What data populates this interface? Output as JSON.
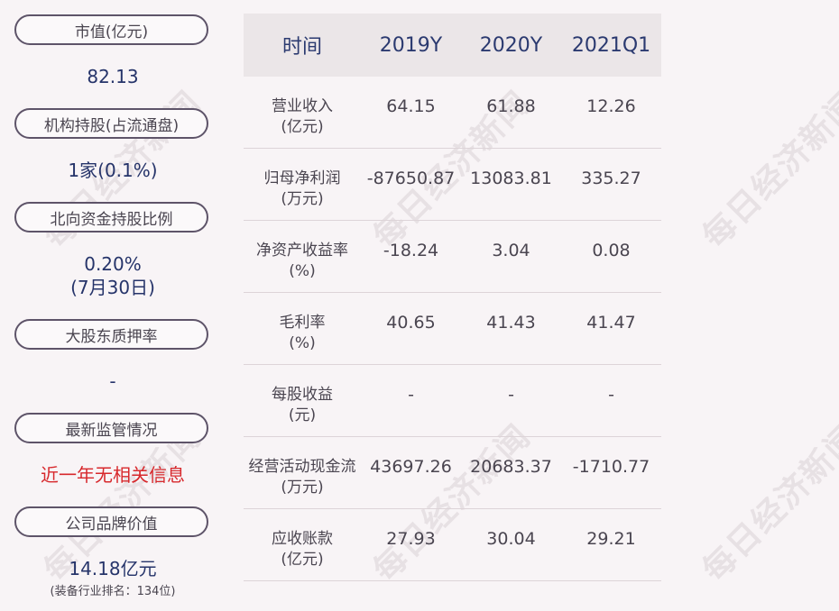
{
  "left": {
    "market_cap_label": "市值(亿元)",
    "market_cap_value": "82.13",
    "institution_label": "机构持股(占流通盘)",
    "institution_value": "1家(0.1%)",
    "northbound_label": "北向资金持股比例",
    "northbound_value": "0.20%",
    "northbound_date": "(7月30日)",
    "pledge_label": "大股东质押率",
    "pledge_value": "-",
    "regulation_label": "最新监管情况",
    "regulation_value": "近一年无相关信息",
    "brand_label": "公司品牌价值",
    "brand_value": "14.18亿元",
    "brand_note": "(装备行业排名：134位)"
  },
  "table": {
    "headers": [
      "时间",
      "2019Y",
      "2020Y",
      "2021Q1"
    ],
    "rows": [
      {
        "label1": "营业收入",
        "label2": "(亿元)",
        "values": [
          "64.15",
          "61.88",
          "12.26"
        ]
      },
      {
        "label1": "归母净利润",
        "label2": "(万元)",
        "values": [
          "-87650.87",
          "13083.81",
          "335.27"
        ]
      },
      {
        "label1": "净资产收益率",
        "label2": "(%)",
        "values": [
          "-18.24",
          "3.04",
          "0.08"
        ]
      },
      {
        "label1": "毛利率",
        "label2": "(%)",
        "values": [
          "40.65",
          "41.43",
          "41.47"
        ]
      },
      {
        "label1": "每股收益",
        "label2": "(元)",
        "values": [
          "-",
          "-",
          "-"
        ]
      },
      {
        "label1": "经营活动现金流",
        "label2": "(万元)",
        "values": [
          "43697.26",
          "20683.37",
          "-1710.77"
        ]
      },
      {
        "label1": "应收账款",
        "label2": "(亿元)",
        "values": [
          "27.93",
          "30.04",
          "29.21"
        ]
      }
    ]
  },
  "watermark": "每日经济新闻"
}
